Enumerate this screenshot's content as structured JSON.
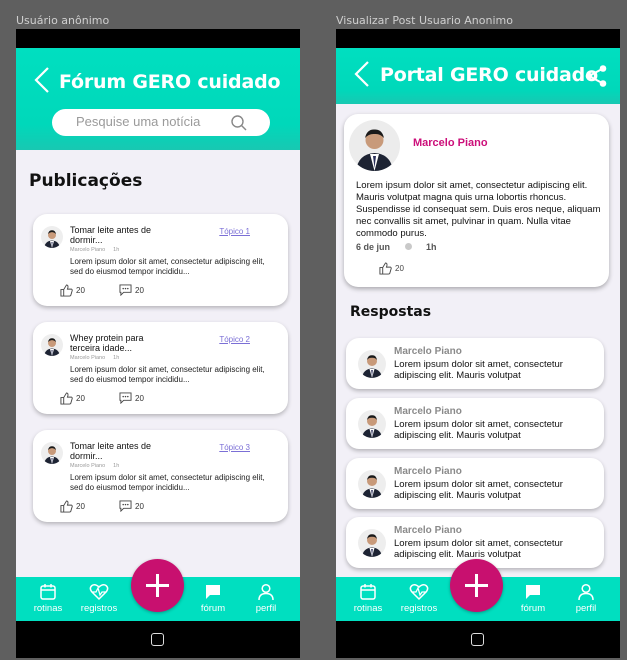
{
  "frames": {
    "left_label": "Usuário anônimo",
    "right_label": "Visualizar Post Usuario Anonimo"
  },
  "forum": {
    "title": "Fórum GERO cuidado",
    "search_placeholder": "Pesquise uma notícia",
    "section_title": "Publicações",
    "posts": [
      {
        "title": "Tomar leite antes de dormir...",
        "topic": "Tópico 1",
        "author": "Marcelo Piano",
        "time": "1h",
        "body": "Lorem ipsum dolor sit amet, consectetur adipiscing elit, sed do eiusmod tempor incididu...",
        "likes": "20",
        "comments": "20"
      },
      {
        "title": "Whey protein para terceira idade...",
        "topic": "Tópico 2",
        "author": "Marcelo Piano",
        "time": "1h",
        "body": "Lorem ipsum dolor sit amet, consectetur adipiscing elit, sed do eiusmod tempor incididu...",
        "likes": "20",
        "comments": "20"
      },
      {
        "title": "Tomar leite antes de dormir...",
        "topic": "Tópico 3",
        "author": "Marcelo Piano",
        "time": "1h",
        "body": "Lorem ipsum dolor sit amet, consectetur adipiscing elit, sed do eiusmod tempor incididu...",
        "likes": "20",
        "comments": "20"
      }
    ]
  },
  "post_view": {
    "title": "Portal GERO cuidado",
    "post": {
      "author": "Marcelo Piano",
      "body": "Lorem ipsum dolor sit amet, consectetur adipiscing elit. Mauris volutpat magna quis urna lobortis rhoncus. Suspendisse id consequat sem. Duis eros neque, aliquam nec convallis sit amet, pulvinar in quam. Nulla vitae commodo purus.",
      "date": "6 de jun",
      "time": "1h",
      "likes": "20"
    },
    "replies_title": "Respostas",
    "replies": [
      {
        "author": "Marcelo Piano",
        "body": "Lorem ipsum dolor sit amet, consectetur adipiscing elit. Mauris volutpat"
      },
      {
        "author": "Marcelo Piano",
        "body": "Lorem ipsum dolor sit amet, consectetur adipiscing elit. Mauris volutpat"
      },
      {
        "author": "Marcelo Piano",
        "body": "Lorem ipsum dolor sit amet, consectetur adipiscing elit. Mauris volutpat"
      },
      {
        "author": "Marcelo Piano",
        "body": "Lorem ipsum dolor sit amet, consectetur adipiscing elit. Mauris volutpat"
      }
    ]
  },
  "nav": {
    "rotinas": "rotinas",
    "registros": "registros",
    "forum": "fórum",
    "perfil": "perfil"
  },
  "colors": {
    "primary": "#00dfc0",
    "accent": "#c8106f",
    "author_pink": "#cc0f7a",
    "topic_link": "#7b6fd6",
    "background": "#f2f0f7"
  },
  "icons": [
    "back-arrow-icon",
    "search-icon",
    "share-icon",
    "thumbs-up-icon",
    "comment-icon",
    "calendar-icon",
    "heart-pulse-icon",
    "plus-icon",
    "chat-icon",
    "person-icon",
    "home-square-icon"
  ]
}
